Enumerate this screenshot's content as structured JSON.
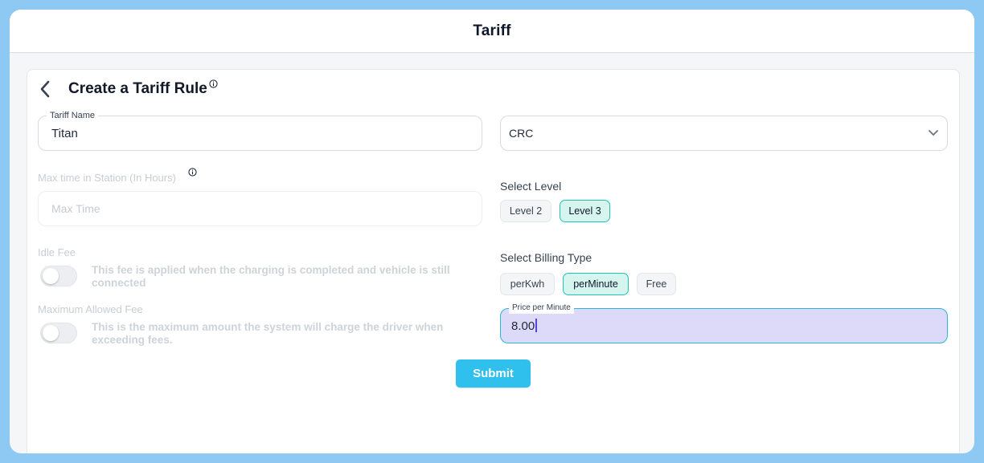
{
  "header": {
    "title": "Tariff"
  },
  "form": {
    "title": "Create a Tariff Rule",
    "tariff_name": {
      "label": "Tariff Name",
      "value": "Titan"
    },
    "currency": {
      "selected": "CRC"
    },
    "max_time": {
      "label": "Max time in Station (In Hours)",
      "placeholder": "Max Time"
    },
    "idle_fee": {
      "label": "Idle Fee",
      "description": "This fee is applied when the charging is completed and vehicle is still connected",
      "enabled": false
    },
    "max_fee": {
      "label": "Maximum Allowed Fee",
      "description": "This is the maximum amount the system will charge the driver when exceeding fees.",
      "enabled": false
    },
    "level": {
      "label": "Select Level",
      "options": [
        "Level 2",
        "Level 3"
      ],
      "selected": "Level 3"
    },
    "billing": {
      "label": "Select Billing Type",
      "options": [
        "perKwh",
        "perMinute",
        "Free"
      ],
      "selected": "perMinute"
    },
    "price": {
      "label": "Price per Minute",
      "value": "8.00"
    },
    "submit_label": "Submit"
  },
  "colors": {
    "accent": "#2fc0ee",
    "selected_chip": "#d6f5ef",
    "selected_chip_border": "#22c3b2",
    "focused_input_bg": "#ddd9f8",
    "focused_input_border": "#2ab7d8",
    "frame": "#8ec9f3"
  },
  "icons": [
    "back-arrow-icon",
    "info-icon",
    "chevron-down-icon"
  ]
}
